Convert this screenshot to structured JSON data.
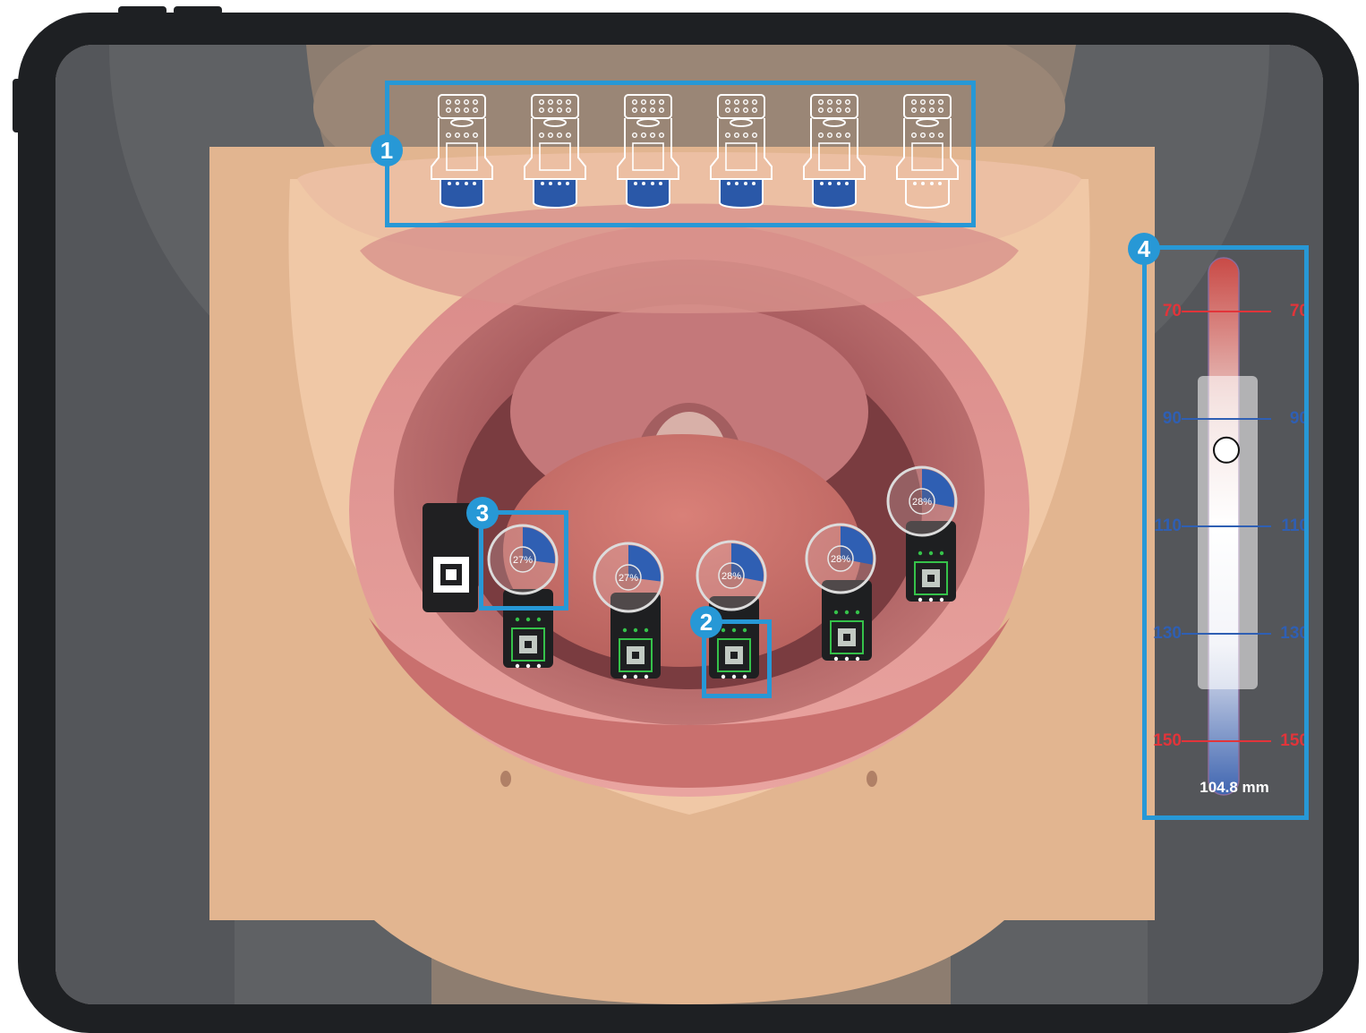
{
  "callouts": [
    "1",
    "2",
    "3",
    "4"
  ],
  "abutment_tray": {
    "count": 6,
    "filled_states": [
      true,
      true,
      true,
      true,
      true,
      false
    ]
  },
  "scan_markers": [
    {
      "progress_label": "27%",
      "progress": 0.27,
      "highlighted": true
    },
    {
      "progress_label": "27%",
      "progress": 0.27,
      "highlighted": false
    },
    {
      "progress_label": "28%",
      "progress": 0.28,
      "highlighted": false
    },
    {
      "progress_label": "28%",
      "progress": 0.28,
      "highlighted": false
    },
    {
      "progress_label": "28%",
      "progress": 0.28,
      "highlighted": false
    }
  ],
  "distance_gauge": {
    "ticks": [
      {
        "label": "70",
        "color": "#e2343a"
      },
      {
        "label": "90",
        "color": "#2f5fb3"
      },
      {
        "label": "110",
        "color": "#2f5fb3"
      },
      {
        "label": "130",
        "color": "#2f5fb3"
      },
      {
        "label": "150",
        "color": "#e2343a"
      }
    ],
    "reading": "104.8 mm",
    "value_mm": 104.8,
    "range_mm": [
      60,
      160
    ]
  },
  "colors": {
    "accent": "#2798d6",
    "progress": "#2f5fb3",
    "target_green": "#35c24a",
    "warning_red": "#e2343a"
  }
}
